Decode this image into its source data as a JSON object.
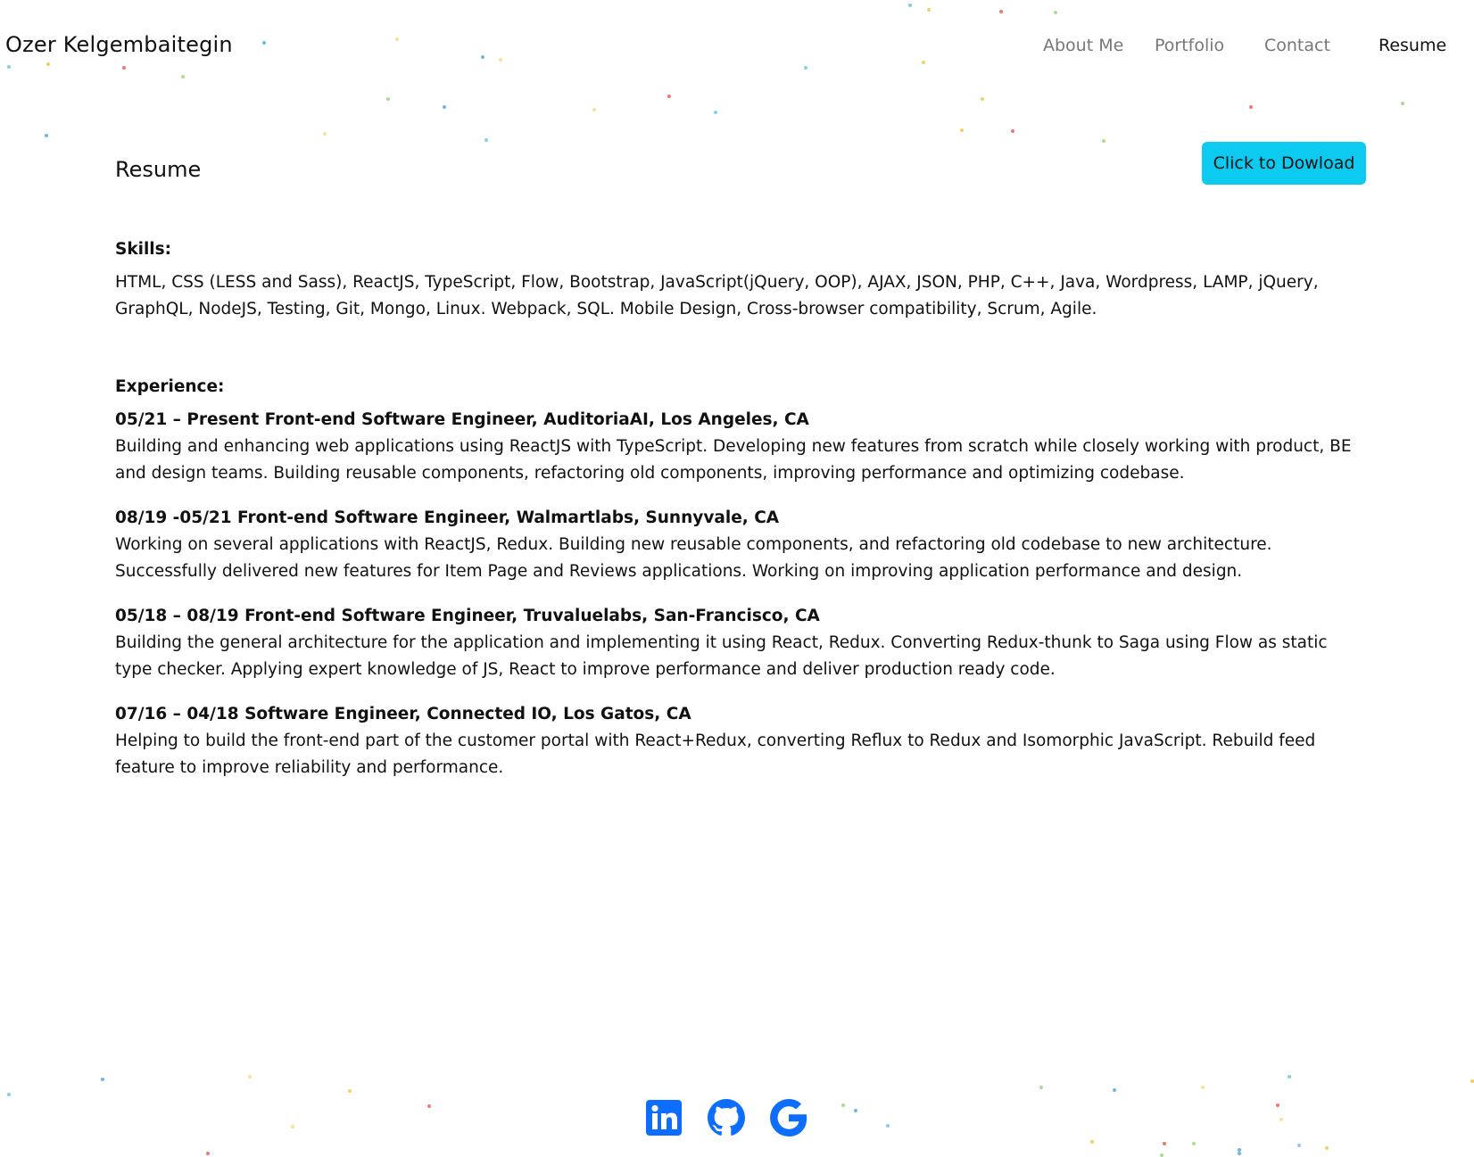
{
  "header": {
    "brand": "Ozer Kelgembaitegin",
    "nav": [
      {
        "label": "About Me",
        "active": false
      },
      {
        "label": "Portfolio",
        "active": false
      },
      {
        "label": "Contact",
        "active": false
      },
      {
        "label": "Resume",
        "active": true
      }
    ]
  },
  "resume": {
    "title": "Resume",
    "download_label": "Click to Dowload",
    "skills_label": "Skills:",
    "skills_text": "HTML, CSS (LESS and Sass), ReactJS, TypeScript, Flow, Bootstrap, JavaScript(jQuery, OOP), AJAX, JSON, PHP, C++, Java, Wordpress, LAMP, jQuery, GraphQL, NodeJS, Testing, Git, Mongo, Linux. Webpack, SQL. Mobile Design, Cross-browser compatibility, Scrum, Agile.",
    "experience_label": "Experience:",
    "experience": [
      {
        "title": "05/21 – Present Front-end Software Engineer, AuditoriaAI, Los Angeles, CA",
        "description": "Building and enhancing web applications using ReactJS with TypeScript. Developing new features from scratch while closely working with product, BE and design teams. Building reusable components, refactoring old components, improving performance and optimizing codebase."
      },
      {
        "title": "08/19 -05/21 Front-end Software Engineer, Walmartlabs, Sunnyvale, CA",
        "description": "Working on several applications with ReactJS, Redux. Building new reusable components, and refactoring old codebase to new architecture. Successfully delivered new features for Item Page and Reviews applications. Working on improving application performance and design."
      },
      {
        "title": "05/18 – 08/19 Front-end Software Engineer, Truvaluelabs, San-Francisco, CA",
        "description": "Building the general architecture for the application and implementing it using React, Redux. Converting Redux-thunk to Saga using Flow as static type checker. Applying expert knowledge of JS, React to improve performance and deliver production ready code."
      },
      {
        "title": "07/16 – 04/18 Software Engineer, Connected IO, Los Gatos, CA",
        "description": "Helping to build the front-end part of the customer portal with React+Redux, converting Reflux to Redux and Isomorphic JavaScript. Rebuild feed feature to improve reliability and performance."
      }
    ]
  },
  "footer": {
    "social": [
      {
        "icon": "linkedin-icon",
        "color": "#0d6efd"
      },
      {
        "icon": "github-icon",
        "color": "#0d6efd"
      },
      {
        "icon": "google-icon",
        "color": "#0d6efd"
      }
    ]
  },
  "colors": {
    "accent_button": "#0dcaf0",
    "social_blue": "#0d6efd",
    "confetti": [
      "#5bc0de",
      "#f0c030",
      "#e74c3c",
      "#8bd46a",
      "#3aa0e0",
      "#f5d76e"
    ]
  }
}
